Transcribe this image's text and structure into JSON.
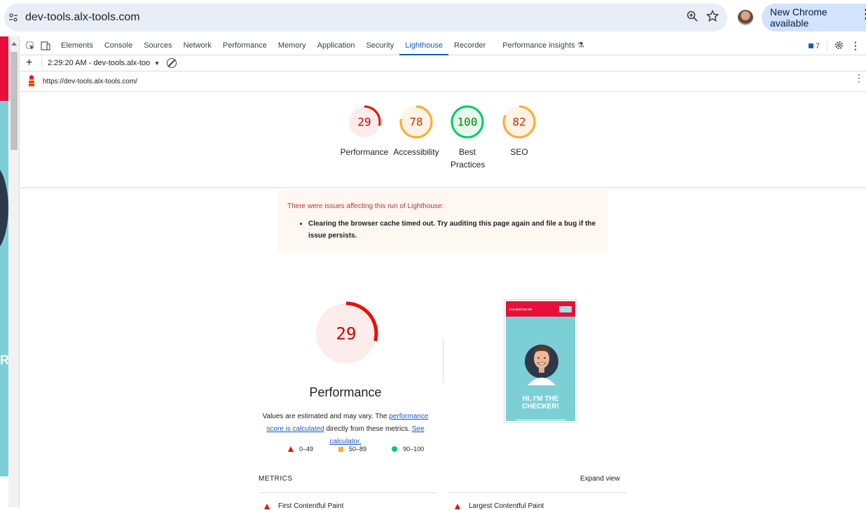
{
  "browser": {
    "url": "dev-tools.alx-tools.com",
    "new_chrome": "New Chrome available"
  },
  "devtools": {
    "tabs": [
      "Elements",
      "Console",
      "Sources",
      "Network",
      "Performance",
      "Memory",
      "Application",
      "Security",
      "Lighthouse",
      "Recorder",
      "Performance insights"
    ],
    "active_tab": "Lighthouse",
    "issues_count": "7",
    "report_label": "2:29:20 AM - dev-tools.alx-too",
    "report_url": "https://dev-tools.alx-tools.com/"
  },
  "scores": [
    {
      "label": "Performance",
      "value": "29",
      "score": 29,
      "color": "#eb0f00",
      "bg": "#fdecec"
    },
    {
      "label": "Accessibility",
      "value": "78",
      "score": 78,
      "color": "#ffaa33",
      "bg": "#fff3e6"
    },
    {
      "label": "Best Practices",
      "value": "100",
      "score": 100,
      "color": "#00cc66",
      "bg": "#e8f8ef"
    },
    {
      "label": "SEO",
      "value": "82",
      "score": 82,
      "color": "#ffaa33",
      "bg": "#fff3e6"
    }
  ],
  "warning": {
    "title": "There were issues affecting this run of Lighthouse:",
    "items": [
      "Clearing the browser cache timed out. Try auditing this page again and file a bug if the issue persists."
    ]
  },
  "performance": {
    "score": "29",
    "title": "Performance",
    "desc_pre": "Values are estimated and may vary. The ",
    "link1": "performance score is calculated",
    "desc_mid": " directly from these metrics. ",
    "link2": "See calculator."
  },
  "legend": [
    "0–49",
    "50–89",
    "90–100"
  ],
  "thumbnail": {
    "brand": "HOLBERTON ME",
    "headline": "HI, I'M THE CHECKER!"
  },
  "metrics": {
    "label": "METRICS",
    "expand": "Expand view",
    "items": [
      "First Contentful Paint",
      "Largest Contentful Paint"
    ]
  }
}
